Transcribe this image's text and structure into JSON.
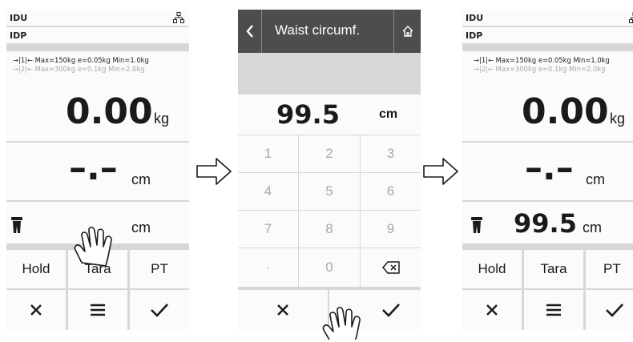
{
  "screen_left": {
    "idu_label": "IDU",
    "idp_label": "IDP",
    "range1": "→|1|← Max=150kg e=0.05kg Min=1.0kg",
    "range2": "→|2|← Max=300kg e=0.1kg Min=2.0kg",
    "weight_value": "0.00",
    "weight_unit": "kg",
    "height_value": "–.–",
    "height_unit": "cm",
    "waist_unit": "cm",
    "buttons": {
      "hold": "Hold",
      "tara": "Tara",
      "pt": "PT"
    }
  },
  "screen_middle": {
    "title": "Waist circumf.",
    "entry_value": "99.5",
    "entry_unit": "cm",
    "keys": [
      "1",
      "2",
      "3",
      "4",
      "5",
      "6",
      "7",
      "8",
      "9",
      "·",
      "0"
    ]
  },
  "screen_right": {
    "idu_label": "IDU",
    "idp_label": "IDP",
    "range1": "→|1|← Max=150kg e=0.05kg Min=1.0kg",
    "range2": "→|2|← Max=300kg e=0.1kg Min=2.0kg",
    "weight_value": "0.00",
    "weight_unit": "kg",
    "height_value": "–.–",
    "height_unit": "cm",
    "waist_value": "99.5",
    "waist_unit": "cm",
    "buttons": {
      "hold": "Hold",
      "tara": "Tara",
      "pt": "PT"
    }
  },
  "icons": {
    "network": "network-icon",
    "waist": "waist-icon",
    "back": "chevron-left-icon",
    "home": "home-icon",
    "cancel": "close-icon",
    "menu": "menu-icon",
    "confirm": "check-icon",
    "backspace": "backspace-icon",
    "hand": "hand-pointer-icon",
    "flow_arrow": "arrow-right-icon"
  },
  "colors": {
    "background": "#d7d7d7",
    "panel": "#fbfbfb",
    "title_bar": "#4d4d4d",
    "text": "#1a1a1a",
    "muted": "#a8a8a8"
  }
}
